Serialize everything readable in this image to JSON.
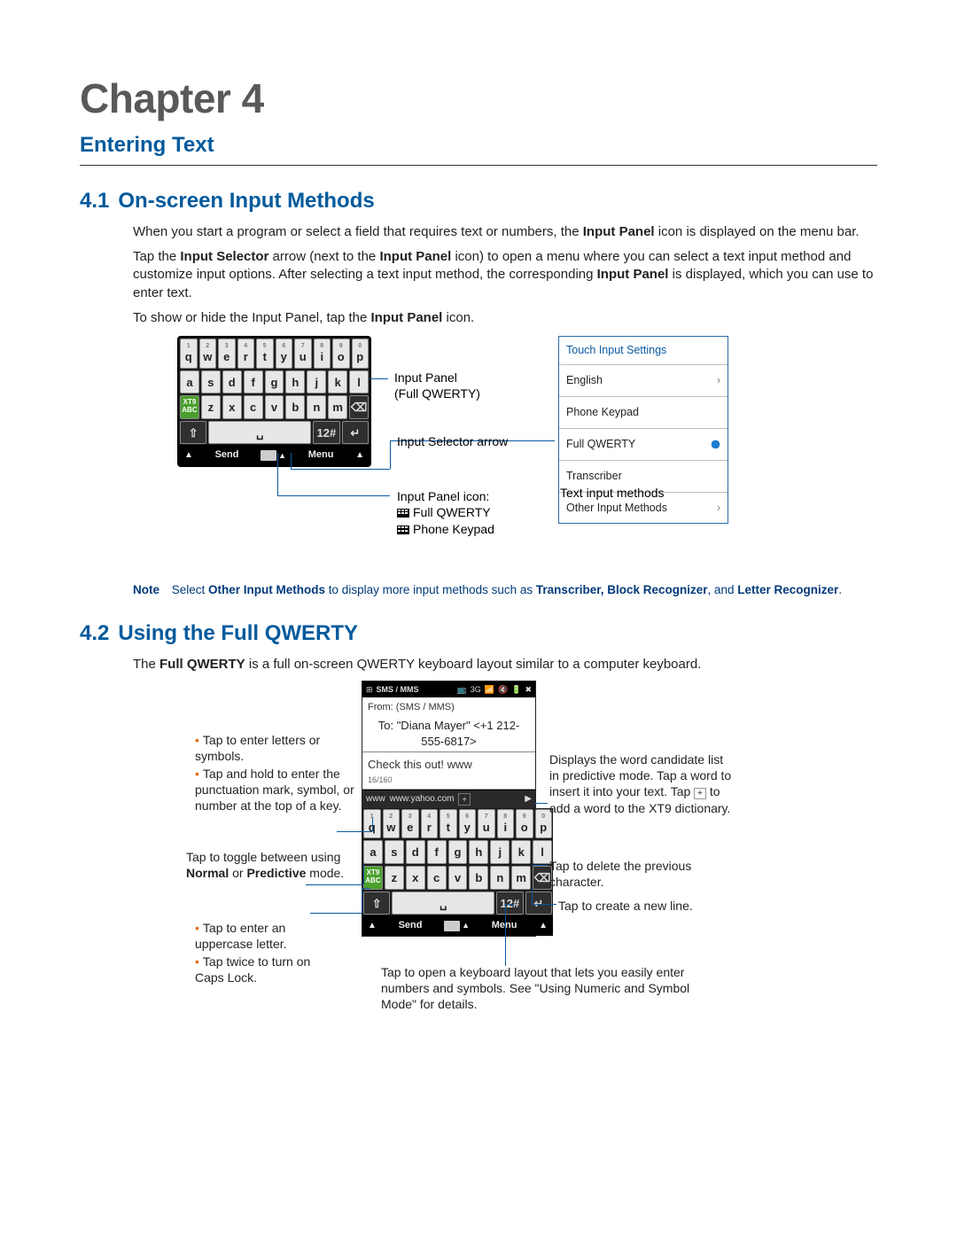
{
  "chapter": {
    "label": "Chapter 4"
  },
  "subtitle": "Entering Text",
  "section1": {
    "num": "4.1",
    "title": "On-screen Input Methods",
    "p1a": "When you start a program or select a field that requires text or numbers, the ",
    "p1b": "Input Panel",
    "p1c": " icon is displayed on the menu bar.",
    "p2a": "Tap the ",
    "p2b": "Input Selector",
    "p2c": " arrow (next to the ",
    "p2d": "Input Panel",
    "p2e": " icon) to open a menu where you can select a text input method and customize input options. After selecting a text input method, the corresponding ",
    "p2f": "Input Panel",
    "p2g": " is displayed, which you can use to enter text.",
    "p3a": "To show or hide the Input Panel, tap the ",
    "p3b": "Input Panel",
    "p3c": " icon."
  },
  "fig1": {
    "input_panel_label_line1": "Input Panel",
    "input_panel_label_line2": "(Full QWERTY)",
    "selector_arrow_label": "Input Selector arrow",
    "text_methods_label": "Text input methods",
    "panel_icon_label": "Input Panel icon:",
    "panel_icon_item1": "Full QWERTY",
    "panel_icon_item2": "Phone Keypad",
    "kbd_rows": [
      [
        "q",
        "w",
        "e",
        "r",
        "t",
        "y",
        "u",
        "i",
        "o",
        "p"
      ],
      [
        "a",
        "s",
        "d",
        "f",
        "g",
        "h",
        "j",
        "k",
        "l"
      ],
      [
        "z",
        "x",
        "c",
        "v",
        "b",
        "n",
        "m"
      ]
    ],
    "kbd_nums": [
      "1",
      "2",
      "3",
      "4",
      "5",
      "6",
      "7",
      "8",
      "9",
      "0"
    ],
    "kbd_xt9": "XT9\nABC",
    "kbd_del": "⌫",
    "kbd_shift": "⇧",
    "kbd_space": "␣",
    "kbd_numkey": "12#",
    "kbd_enter": "↵",
    "kbd_send": "Send",
    "kbd_menu": "Menu",
    "settings": {
      "header": "Touch Input Settings",
      "items": [
        "English",
        "Phone Keypad",
        "Full QWERTY",
        "Transcriber",
        "Other Input Methods"
      ],
      "selected_index": 2
    }
  },
  "note": {
    "label": "Note",
    "a": "Select ",
    "b": "Other Input Methods",
    "c": " to display more input methods such as ",
    "d": "Transcriber, Block Recognizer",
    "e": ", and ",
    "f": "Letter Recognizer",
    "g": "."
  },
  "section2": {
    "num": "4.2",
    "title": "Using the Full QWERTY",
    "p1a": "The ",
    "p1b": "Full QWERTY",
    "p1c": " is a full on-screen QWERTY keyboard layout similar to a computer keyboard."
  },
  "fig2": {
    "phone": {
      "status_app": "SMS / MMS",
      "from": "From: (SMS / MMS)",
      "to_a": "To: ",
      "to_b": "\"Diana Mayer\" <+1 212-555-6817>",
      "msg": "Check this out! www",
      "count": "16/160",
      "cand1": "www",
      "cand2": "www.yahoo.com",
      "add": "+",
      "send": "Send",
      "menu": "Menu"
    },
    "left": {
      "b1": "Tap to enter letters or symbols.",
      "b2": "Tap and hold to enter the punctuation mark, symbol, or number at the top of a key.",
      "mode1": "Tap to toggle between using ",
      "mode2": "Normal",
      "mode3": " or ",
      "mode4": "Predictive",
      "mode5": " mode.",
      "b3": "Tap to enter an uppercase letter.",
      "b4": "Tap twice to turn on Caps Lock."
    },
    "right": {
      "r1a": "Displays the word candidate list in predictive mode. Tap a word to insert it into your text. Tap ",
      "r1b": " to add a word to the XT9 dictionary.",
      "r2": "Tap to delete the previous character.",
      "r3": "Tap to create a new line."
    },
    "bottom": "Tap to open a keyboard layout that lets you easily enter numbers and symbols. See \"Using Numeric and Symbol Mode\" for details."
  }
}
